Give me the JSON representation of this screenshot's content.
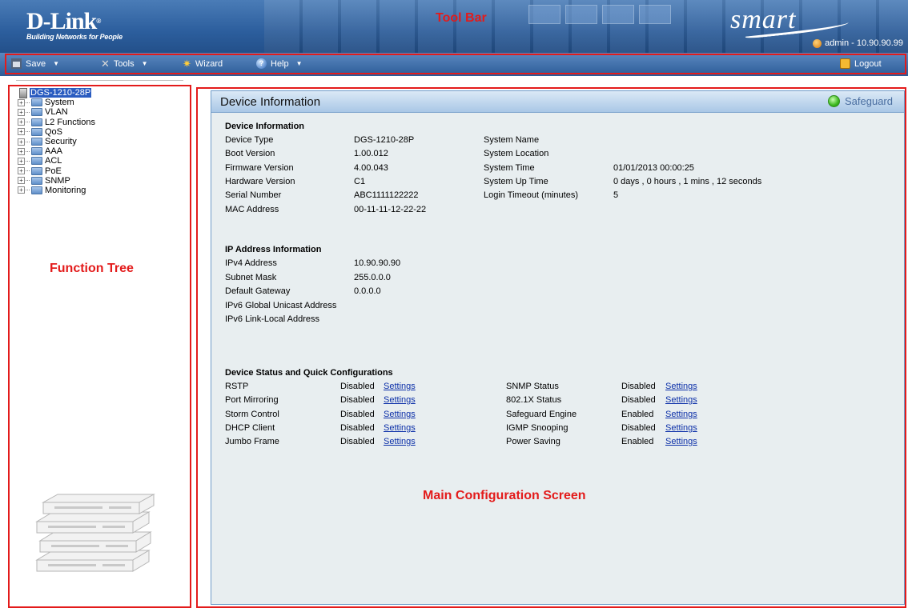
{
  "header": {
    "logo": "D-Link",
    "logo_reg": "®",
    "tagline": "Building Networks for People",
    "smart_logo": "smart",
    "user_info": "admin - 10.90.90.99"
  },
  "annotations": {
    "toolbar": "Tool Bar",
    "function_tree": "Function Tree",
    "main_screen": "Main Configuration Screen"
  },
  "menubar": {
    "save": "Save",
    "tools": "Tools",
    "wizard": "Wizard",
    "help": "Help",
    "logout": "Logout"
  },
  "tree": {
    "root": "DGS-1210-28P",
    "items": [
      "System",
      "VLAN",
      "L2 Functions",
      "QoS",
      "Security",
      "AAA",
      "ACL",
      "PoE",
      "SNMP",
      "Monitoring"
    ]
  },
  "panel": {
    "title": "Device Information",
    "safeguard": "Safeguard"
  },
  "device_info": {
    "section": "Device Information",
    "left": [
      {
        "label": "Device Type",
        "value": "DGS-1210-28P"
      },
      {
        "label": "Boot Version",
        "value": "1.00.012"
      },
      {
        "label": "Firmware Version",
        "value": "4.00.043"
      },
      {
        "label": "Hardware Version",
        "value": "C1"
      },
      {
        "label": "Serial Number",
        "value": "ABC1111122222"
      },
      {
        "label": "MAC Address",
        "value": "00-11-11-12-22-22"
      }
    ],
    "right": [
      {
        "label": "System Name",
        "value": ""
      },
      {
        "label": "System Location",
        "value": ""
      },
      {
        "label": "System Time",
        "value": "01/01/2013 00:00:25"
      },
      {
        "label": "System Up Time",
        "value": "0 days , 0 hours , 1 mins , 12 seconds"
      },
      {
        "label": "Login Timeout (minutes)",
        "value": "5"
      }
    ]
  },
  "ip_info": {
    "section": "IP Address Information",
    "rows": [
      {
        "label": "IPv4 Address",
        "value": "10.90.90.90"
      },
      {
        "label": "Subnet Mask",
        "value": "255.0.0.0"
      },
      {
        "label": "Default Gateway",
        "value": "0.0.0.0"
      },
      {
        "label": "IPv6 Global Unicast Address",
        "value": ""
      },
      {
        "label": "IPv6 Link-Local Address",
        "value": ""
      }
    ]
  },
  "status": {
    "section": "Device Status and Quick Configurations",
    "link_label": "Settings",
    "left": [
      {
        "label": "RSTP",
        "value": "Disabled"
      },
      {
        "label": "Port Mirroring",
        "value": "Disabled"
      },
      {
        "label": "Storm Control",
        "value": "Disabled"
      },
      {
        "label": "DHCP Client",
        "value": "Disabled"
      },
      {
        "label": "Jumbo Frame",
        "value": "Disabled"
      }
    ],
    "right": [
      {
        "label": "SNMP Status",
        "value": "Disabled"
      },
      {
        "label": "802.1X Status",
        "value": "Disabled"
      },
      {
        "label": "Safeguard Engine",
        "value": "Enabled"
      },
      {
        "label": "IGMP Snooping",
        "value": "Disabled"
      },
      {
        "label": "Power Saving",
        "value": "Enabled"
      }
    ]
  },
  "colors": {
    "annotation": "#e31b1b",
    "header_blue": "#2c5e9d",
    "link": "#0b2fa8",
    "panel_bg": "#e8eef0"
  }
}
